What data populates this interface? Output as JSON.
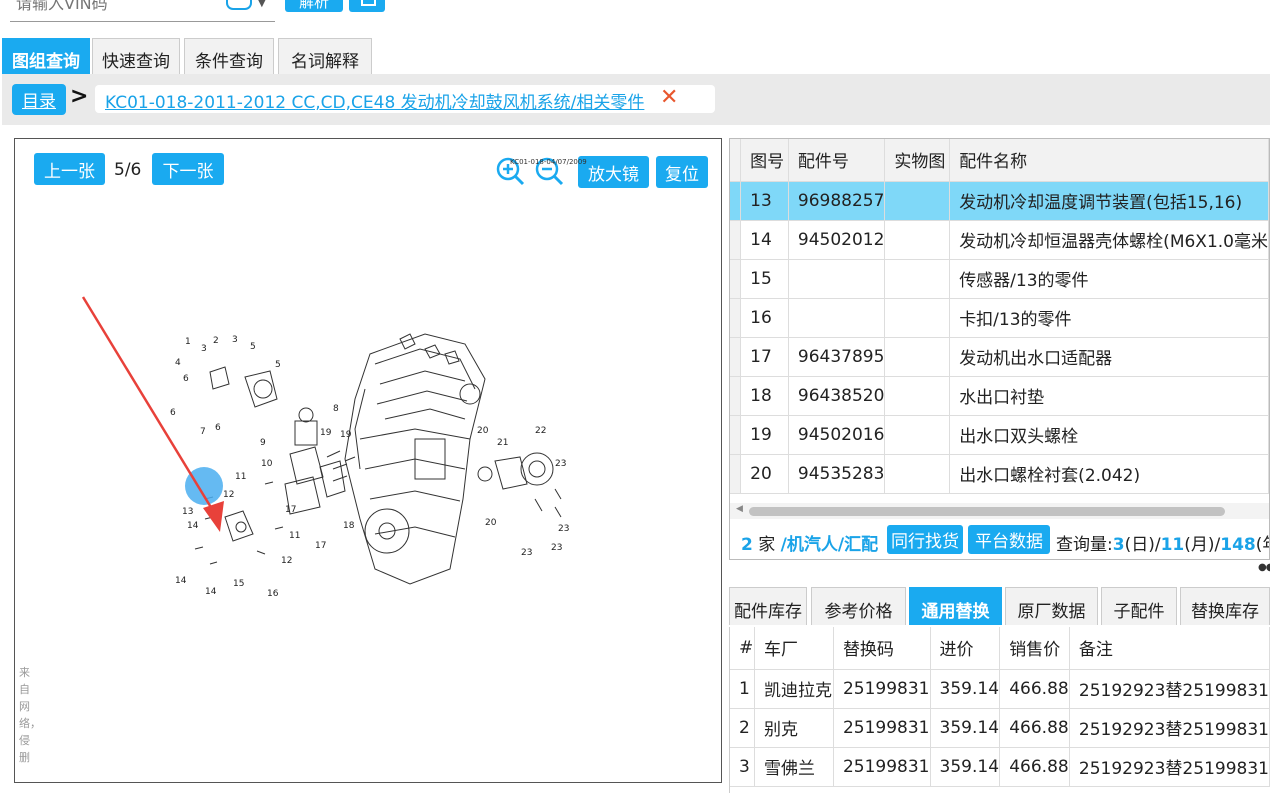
{
  "search": {
    "placeholder": "请输入VIN码",
    "parse_label": "解析"
  },
  "tabs": [
    {
      "label": "图组查询",
      "active": true
    },
    {
      "label": "快速查询",
      "active": false
    },
    {
      "label": "条件查询",
      "active": false
    },
    {
      "label": "名词解释",
      "active": false
    }
  ],
  "breadcrumb": {
    "home_label": "目录",
    "item_label": "KC01-018-2011-2012 CC,CD,CE48 发动机冷却鼓风机系统/相关零件"
  },
  "diagram": {
    "prev_label": "上一张",
    "page_indicator": "5/6",
    "next_label": "下一张",
    "magnifier_label": "放大镜",
    "reset_label": "复位",
    "code_label": "KC01-018-04/07/2009",
    "side_note": "来自网络，侵删",
    "callouts": [
      "1",
      "2",
      "3",
      "3",
      "4",
      "5",
      "5",
      "6",
      "6",
      "6",
      "7",
      "8",
      "9",
      "10",
      "11",
      "11",
      "12",
      "12",
      "13",
      "14",
      "14",
      "14",
      "15",
      "16",
      "17",
      "17",
      "18",
      "19",
      "19",
      "20",
      "20",
      "21",
      "22",
      "23",
      "23",
      "23",
      "23"
    ]
  },
  "parts_table": {
    "headers": [
      "图号",
      "配件号",
      "实物图",
      "配件名称"
    ],
    "rows": [
      {
        "no": "13",
        "part": "96988257",
        "img": "",
        "name": "发动机冷却温度调节装置(包括15,16)",
        "selected": true
      },
      {
        "no": "14",
        "part": "94502012",
        "img": "",
        "name": "发动机冷却恒温器壳体螺栓(M6X1.0毫米",
        "selected": false
      },
      {
        "no": "15",
        "part": "",
        "img": "",
        "name": "传感器/13的零件",
        "selected": false
      },
      {
        "no": "16",
        "part": "",
        "img": "",
        "name": "卡扣/13的零件",
        "selected": false
      },
      {
        "no": "17",
        "part": "96437895",
        "img": "",
        "name": "发动机出水口适配器",
        "selected": false
      },
      {
        "no": "18",
        "part": "96438520",
        "img": "",
        "name": "水出口衬垫",
        "selected": false
      },
      {
        "no": "19",
        "part": "94502016",
        "img": "",
        "name": "出水口双头螺栓",
        "selected": false
      },
      {
        "no": "20",
        "part": "94535283",
        "img": "",
        "name": "出水口螺栓衬套(2.042)",
        "selected": false
      }
    ]
  },
  "parts_footer": {
    "count": "2",
    "count_suffix": "家",
    "sources": "/机汽人/汇配",
    "same_find_label": "同行找货",
    "platform_label": "平台数据",
    "query_prefix": "查询量:",
    "day_count": "3",
    "day_label": "(日)/",
    "month_count": "11",
    "month_label": "(月)/",
    "year_count": "148",
    "year_label": "(年)"
  },
  "bottom_tabs": [
    {
      "label": "配件库存",
      "active": false
    },
    {
      "label": "参考价格",
      "active": false
    },
    {
      "label": "通用替换",
      "active": true
    },
    {
      "label": "原厂数据",
      "active": false
    },
    {
      "label": "子配件",
      "active": false
    },
    {
      "label": "替换库存",
      "active": false
    }
  ],
  "subs_table": {
    "headers": [
      "#",
      "车厂",
      "替换码",
      "进价",
      "销售价",
      "备注"
    ],
    "rows": [
      {
        "idx": "1",
        "maker": "凯迪拉克",
        "code": "25199831",
        "cost": "359.14",
        "price": "466.88",
        "note": "25192923替25199831"
      },
      {
        "idx": "2",
        "maker": "别克",
        "code": "25199831",
        "cost": "359.14",
        "price": "466.88",
        "note": "25192923替25199831"
      },
      {
        "idx": "3",
        "maker": "雪佛兰",
        "code": "25199831",
        "cost": "359.14",
        "price": "466.88",
        "note": "25192923替25199831"
      }
    ]
  },
  "colors": {
    "accent": "#1aaaf0",
    "selected_row": "#7fd8f8",
    "link": "#1aa3e8",
    "close": "#e8572e",
    "arrow": "#e8413a",
    "highlight": "#4aaef0"
  }
}
